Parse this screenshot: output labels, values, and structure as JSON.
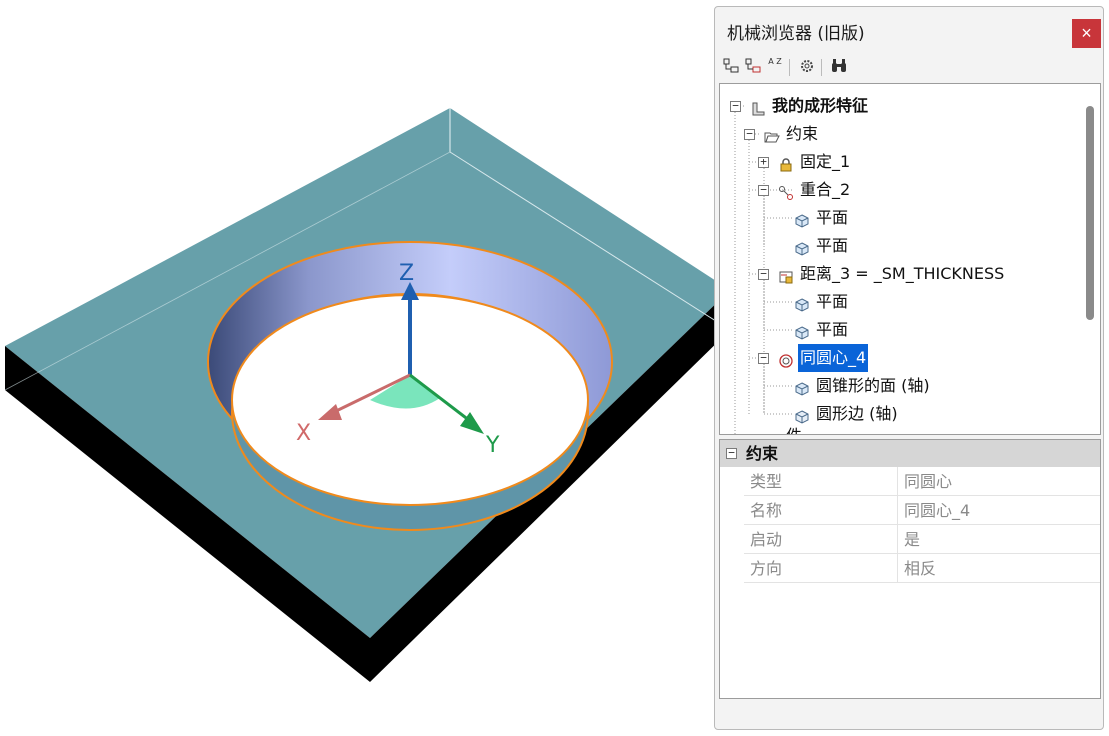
{
  "panel": {
    "title": "机械浏览器 (旧版)",
    "close_label": "×"
  },
  "toolbar": {
    "icons": [
      "tree-expand-icon",
      "tree-collapse-icon",
      "sort-az-icon",
      "settings-gear-icon",
      "binoculars-icon"
    ],
    "sort_label": "A Z"
  },
  "tree": {
    "root": "我的成形特征",
    "constraints": "约束",
    "fixed_1": "固定_1",
    "coincident_2": "重合_2",
    "plane_a": "平面",
    "plane_b": "平面",
    "distance_3": "距离_3 =  _SM_THICKNESS",
    "plane_c": "平面",
    "plane_d": "平面",
    "concentric_4": "同圆心_4",
    "cone_face": "圆锥形的面 (轴)",
    "circle_edge": "圆形边 (轴)",
    "partial_next": "件"
  },
  "properties": {
    "section": "约束",
    "rows": [
      {
        "key": "类型",
        "value": "同圆心"
      },
      {
        "key": "名称",
        "value": "同圆心_4"
      },
      {
        "key": "启动",
        "value": "是"
      },
      {
        "key": "方向",
        "value": "相反"
      }
    ]
  },
  "viewport": {
    "axes": {
      "x": "X",
      "y": "Y",
      "z": "Z"
    },
    "colors": {
      "plate_top": "#67a0aa",
      "plate_side": "#000000",
      "ring_outline": "#f08a1c",
      "x_axis": "#c96b6b",
      "y_axis": "#1e9a4a",
      "z_axis": "#1f5fb0",
      "selection": "#0a64d8"
    }
  }
}
